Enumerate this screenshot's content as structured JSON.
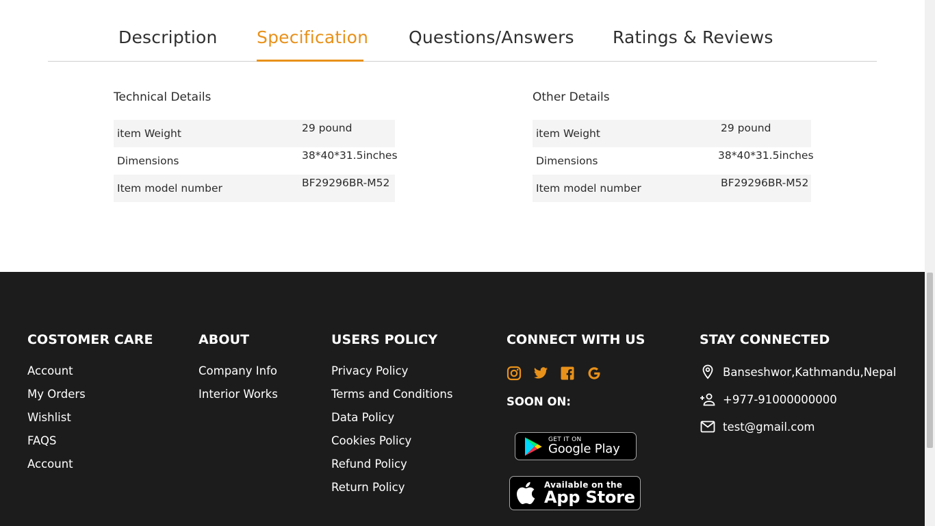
{
  "tabs": [
    {
      "label": "Description",
      "active": false
    },
    {
      "label": "Specification",
      "active": true
    },
    {
      "label": "Questions/Answers",
      "active": false
    },
    {
      "label": "Ratings & Reviews",
      "active": false
    }
  ],
  "accent_color": "#e8911a",
  "technical_details": {
    "title": "Technical Details",
    "rows": [
      {
        "key": "item Weight",
        "value": "29 pound"
      },
      {
        "key": "Dimensions",
        "value": "38*40*31.5inches"
      },
      {
        "key": "Item model number",
        "value": "BF29296BR-M52"
      }
    ]
  },
  "other_details": {
    "title": "Other Details",
    "rows": [
      {
        "key": "item Weight",
        "value": "29 pound"
      },
      {
        "key": "Dimensions",
        "value": "38*40*31.5inches"
      },
      {
        "key": "Item model number",
        "value": "BF29296BR-M52"
      }
    ]
  },
  "footer": {
    "customer_care": {
      "heading": "COSTOMER CARE",
      "links": [
        "Account",
        "My Orders",
        "Wishlist",
        "FAQS",
        "Account"
      ]
    },
    "about": {
      "heading": "ABOUT",
      "links": [
        "Company Info",
        "Interior Works"
      ]
    },
    "users_policy": {
      "heading": "USERS POLICY",
      "links": [
        "Privacy Policy",
        "Terms and Conditions",
        "Data Policy",
        "Cookies Policy",
        "Refund Policy",
        "Return Policy"
      ]
    },
    "connect": {
      "heading": "CONNECT WITH US",
      "social_icons": [
        "instagram-icon",
        "twitter-icon",
        "facebook-icon",
        "google-icon"
      ],
      "soon_label": "SOON ON:",
      "google_play": {
        "small": "GET IT ON",
        "big": "Google Play"
      },
      "app_store": {
        "small": "Available on the",
        "big": "App Store"
      }
    },
    "stay_connected": {
      "heading": "STAY CONNECTED",
      "address": "Banseshwor,Kathmandu,Nepal",
      "phone": "+977-91000000000",
      "email": "test@gmail.com"
    }
  }
}
